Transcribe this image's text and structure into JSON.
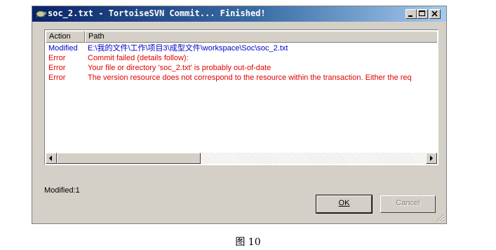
{
  "window": {
    "title": "soc_2.txt - TortoiseSVN Commit... Finished!",
    "title_icon": "tortoise-icon",
    "controls": [
      "minimize-icon",
      "maximize-icon",
      "close-icon"
    ]
  },
  "list": {
    "columns": [
      "Action",
      "Path"
    ],
    "rows": [
      {
        "action": "Modified",
        "path": "E:\\我的文件\\工作\\项目3\\成型文件\\workspace\\Soc\\soc_2.txt",
        "color": "#0000cc"
      },
      {
        "action": "Error",
        "path": "Commit failed (details follow):",
        "color": "#e00000"
      },
      {
        "action": "Error",
        "path": "Your file or directory 'soc_2.txt' is probably out-of-date",
        "color": "#e00000"
      },
      {
        "action": "Error",
        "path": "The version resource does not correspond to the resource within the transaction.  Either the req",
        "color": "#e00000"
      }
    ]
  },
  "status": {
    "text": "Modified:1"
  },
  "buttons": {
    "ok": "OK",
    "cancel": "Cancel"
  },
  "caption": "图 10"
}
